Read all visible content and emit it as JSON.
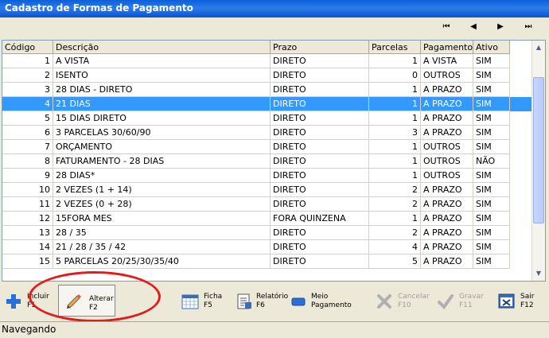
{
  "window": {
    "title": "Cadastro de Formas de Pagamento"
  },
  "nav": {
    "first": "⏮",
    "prev": "◀",
    "next": "▶",
    "last": "⏭"
  },
  "grid": {
    "headers": [
      "Código",
      "Descrição",
      "Prazo",
      "Parcelas",
      "Pagamento",
      "Ativo"
    ],
    "selected_row": 3,
    "rows": [
      [
        "1",
        "A VISTA",
        "DIRETO",
        "1",
        "A VISTA",
        "SIM"
      ],
      [
        "2",
        "ISENTO",
        "DIRETO",
        "0",
        "OUTROS",
        "SIM"
      ],
      [
        "3",
        "28 DIAS - DIRETO",
        "DIRETO",
        "1",
        "A PRAZO",
        "SIM"
      ],
      [
        "4",
        "21 DIAS",
        "DIRETO",
        "1",
        "A PRAZO",
        "SIM"
      ],
      [
        "5",
        "15 DIAS DIRETO",
        "DIRETO",
        "1",
        "A PRAZO",
        "SIM"
      ],
      [
        "6",
        "3 PARCELAS 30/60/90",
        "DIRETO",
        "3",
        "A PRAZO",
        "SIM"
      ],
      [
        "7",
        "ORÇAMENTO",
        "DIRETO",
        "1",
        "OUTROS",
        "SIM"
      ],
      [
        "8",
        "FATURAMENTO - 28 DIAS",
        "DIRETO",
        "1",
        "OUTROS",
        "NÃO"
      ],
      [
        "9",
        "28 DIAS*",
        "DIRETO",
        "1",
        "OUTROS",
        "SIM"
      ],
      [
        "10",
        "2 VEZES (1 + 14)",
        "DIRETO",
        "2",
        "A PRAZO",
        "SIM"
      ],
      [
        "11",
        "2 VEZES (0 + 28)",
        "DIRETO",
        "2",
        "A PRAZO",
        "SIM"
      ],
      [
        "12",
        "15FORA MES",
        "FORA QUINZENA",
        "1",
        "A PRAZO",
        "SIM"
      ],
      [
        "13",
        "28 / 35",
        "DIRETO",
        "2",
        "A PRAZO",
        "SIM"
      ],
      [
        "14",
        "21 / 28 / 35 / 42",
        "DIRETO",
        "4",
        "A PRAZO",
        "SIM"
      ],
      [
        "15",
        "5 PARCELAS 20/25/30/35/40",
        "DIRETO",
        "5",
        "A PRAZO",
        "SIM"
      ]
    ]
  },
  "toolbar": {
    "incluir": {
      "label": "Incluir",
      "key": "F1"
    },
    "alterar": {
      "label": "Alterar",
      "key": "F2"
    },
    "ficha": {
      "label": "Ficha",
      "key": "F5"
    },
    "relatorio": {
      "label": "Relatório",
      "key": "F6"
    },
    "meio": {
      "label": "Meio",
      "label2": "Pagamento"
    },
    "cancelar": {
      "label": "Cancelar",
      "key": "F10"
    },
    "gravar": {
      "label": "Gravar",
      "key": "F11"
    },
    "sair": {
      "label": "Sair",
      "key": "F12"
    }
  },
  "status": {
    "text": "Navegando"
  },
  "colors": {
    "selection": "#3399ff",
    "highlight_circle": "#e21b1b",
    "title_bar": "#0a5fd8"
  }
}
